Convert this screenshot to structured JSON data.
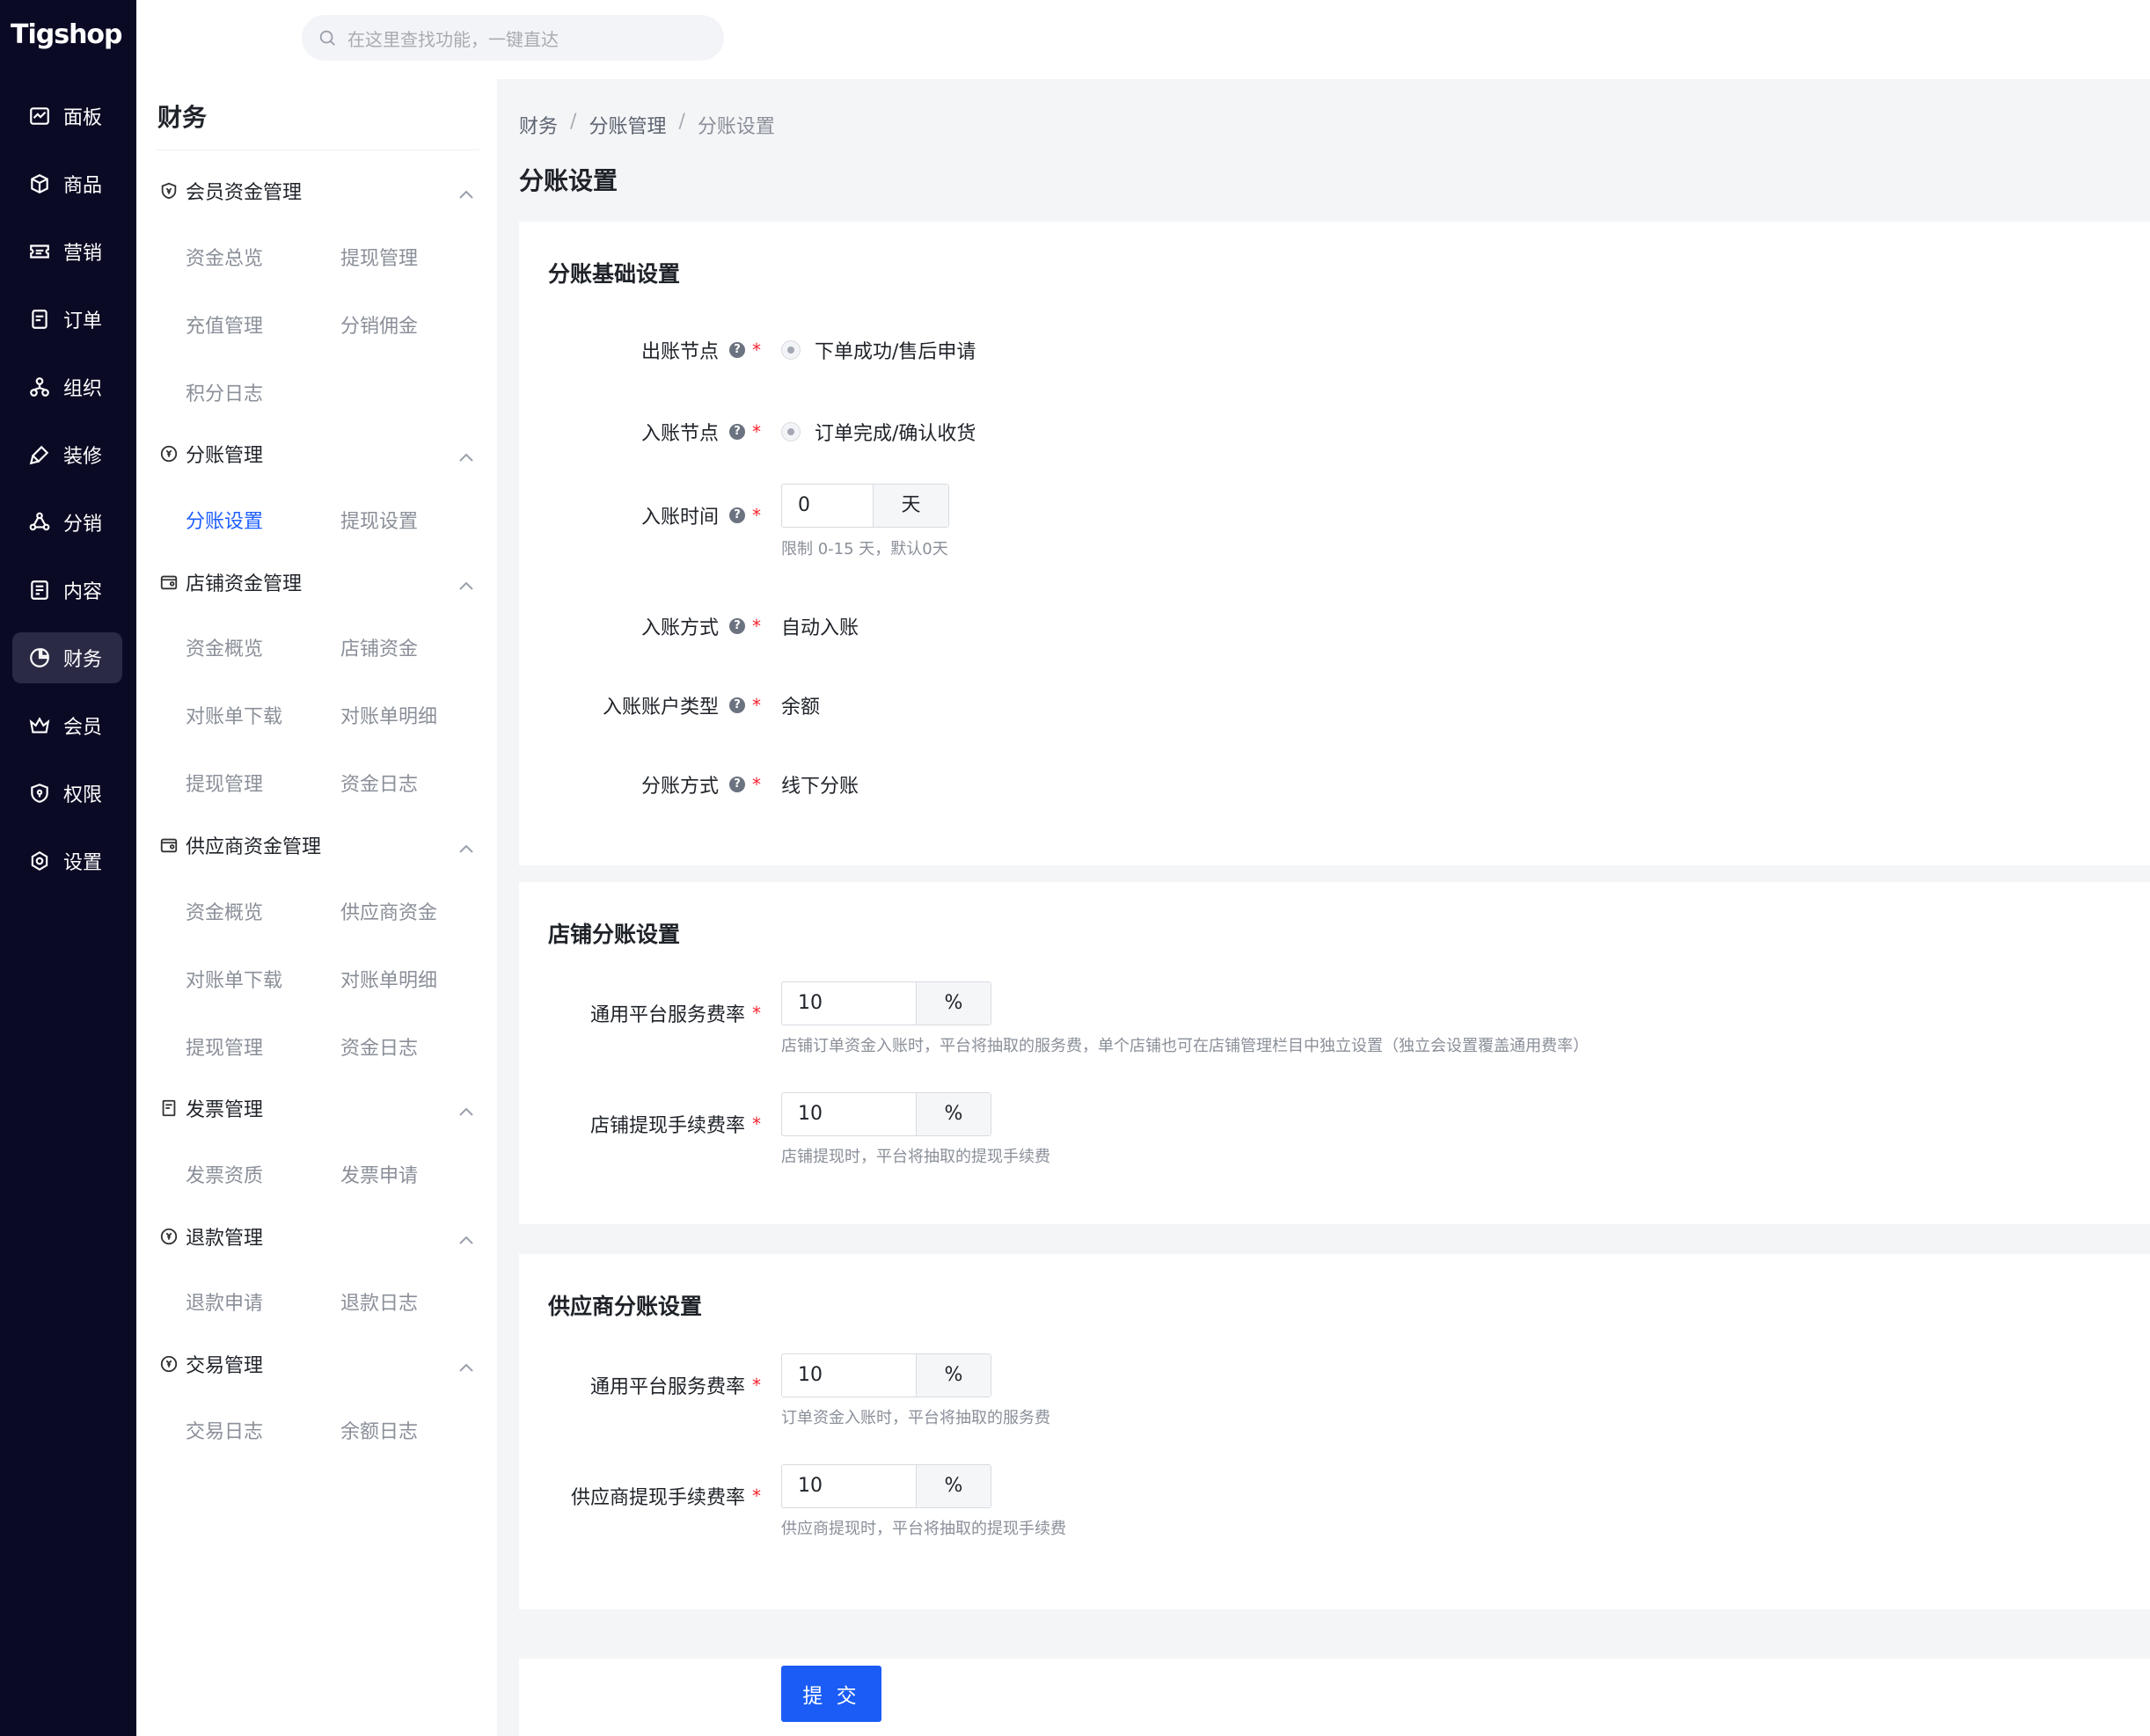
{
  "app": {
    "logo": "Tigshop"
  },
  "search": {
    "placeholder": "在这里查找功能，一键直达"
  },
  "nav": {
    "items": [
      {
        "label": "面板",
        "icon": "dashboard-icon"
      },
      {
        "label": "商品",
        "icon": "box-icon"
      },
      {
        "label": "营销",
        "icon": "ticket-icon"
      },
      {
        "label": "订单",
        "icon": "order-icon"
      },
      {
        "label": "组织",
        "icon": "org-icon"
      },
      {
        "label": "装修",
        "icon": "brush-icon"
      },
      {
        "label": "分销",
        "icon": "share-icon"
      },
      {
        "label": "内容",
        "icon": "content-icon"
      },
      {
        "label": "财务",
        "icon": "pie-icon",
        "active": true
      },
      {
        "label": "会员",
        "icon": "crown-icon"
      },
      {
        "label": "权限",
        "icon": "shield-icon"
      },
      {
        "label": "设置",
        "icon": "gear-icon"
      }
    ]
  },
  "submenu": {
    "title": "财务",
    "groups": [
      {
        "label": "会员资金管理",
        "links": [
          "资金总览",
          "提现管理",
          "充值管理",
          "分销佣金",
          "积分日志"
        ]
      },
      {
        "label": "分账管理",
        "links": [
          "分账设置",
          "提现设置"
        ]
      },
      {
        "label": "店铺资金管理",
        "links": [
          "资金概览",
          "店铺资金",
          "对账单下载",
          "对账单明细",
          "提现管理",
          "资金日志"
        ]
      },
      {
        "label": "供应商资金管理",
        "links": [
          "资金概览",
          "供应商资金",
          "对账单下载",
          "对账单明细",
          "提现管理",
          "资金日志"
        ]
      },
      {
        "label": "发票管理",
        "links": [
          "发票资质",
          "发票申请"
        ]
      },
      {
        "label": "退款管理",
        "links": [
          "退款申请",
          "退款日志"
        ]
      },
      {
        "label": "交易管理",
        "links": [
          "交易日志",
          "余额日志"
        ]
      }
    ]
  },
  "breadcrumb": [
    "财务",
    "分账管理",
    "分账设置"
  ],
  "page": {
    "title": "分账设置"
  },
  "basic": {
    "title": "分账基础设置",
    "payout_node": {
      "label": "出账节点",
      "option": "下单成功/售后申请"
    },
    "entry_node": {
      "label": "入账节点",
      "option": "订单完成/确认收货"
    },
    "entry_time": {
      "label": "入账时间",
      "value": "0",
      "unit": "天",
      "hint": "限制 0-15 天，默认0天"
    },
    "entry_method": {
      "label": "入账方式",
      "value": "自动入账"
    },
    "account_type": {
      "label": "入账账户类型",
      "value": "余额"
    },
    "split_method": {
      "label": "分账方式",
      "value": "线下分账"
    }
  },
  "store": {
    "title": "店铺分账设置",
    "service_rate": {
      "label": "通用平台服务费率",
      "value": "10",
      "unit": "%",
      "hint": "店铺订单资金入账时，平台将抽取的服务费，单个店铺也可在店铺管理栏目中独立设置（独立会设置覆盖通用费率）"
    },
    "withdraw_rate": {
      "label": "店铺提现手续费率",
      "value": "10",
      "unit": "%",
      "hint": "店铺提现时，平台将抽取的提现手续费"
    }
  },
  "supplier": {
    "title": "供应商分账设置",
    "service_rate": {
      "label": "通用平台服务费率",
      "value": "10",
      "unit": "%",
      "hint": "订单资金入账时，平台将抽取的服务费"
    },
    "withdraw_rate": {
      "label": "供应商提现手续费率",
      "value": "10",
      "unit": "%",
      "hint": "供应商提现时，平台将抽取的提现手续费"
    }
  },
  "actions": {
    "submit": "提 交"
  },
  "colors": {
    "accent": "#1a5cf5",
    "nav_bg": "#0b0a24",
    "required": "#f5222d"
  }
}
